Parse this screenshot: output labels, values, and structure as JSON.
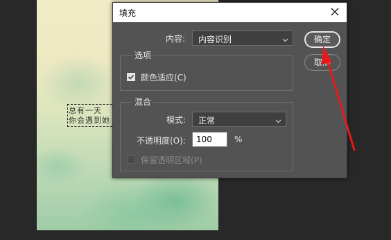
{
  "canvas": {
    "text_lines": [
      "总有一天",
      "你会遇到她"
    ]
  },
  "dialog": {
    "title": "填充",
    "close_icon": "close-icon",
    "content": {
      "label": "内容:",
      "selected": "内容识别"
    },
    "options": {
      "title": "选项",
      "color_adapt_label": "颜色适应(C)",
      "color_adapt_checked": true
    },
    "blend": {
      "title": "混合",
      "mode_label": "模式:",
      "mode_selected": "正常",
      "opacity_label": "不透明度(O):",
      "opacity_value": "100",
      "opacity_unit": "%",
      "preserve_label": "保留透明区域(P)",
      "preserve_checked": false
    },
    "buttons": {
      "ok_label": "确定",
      "cancel_label": "取消"
    }
  },
  "colors": {
    "annotation_arrow": "#e8191b",
    "dialog_bg": "#535353"
  }
}
